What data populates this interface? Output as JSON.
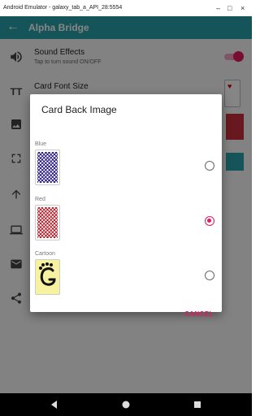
{
  "window": {
    "title": "Android Emulator - galaxy_tab_a_API_28:5554"
  },
  "appbar": {
    "title": "Alpha Bridge"
  },
  "settings": {
    "sound_title": "Sound Effects",
    "sound_subtitle": "Tap to turn sound ON/OFF",
    "font_title": "Card Font Size",
    "sound_enabled": true
  },
  "dialog": {
    "title": "Card Back Image",
    "options": [
      {
        "label": "Blue",
        "selected": false
      },
      {
        "label": "Red",
        "selected": true
      },
      {
        "label": "Cartoon",
        "selected": false
      }
    ],
    "cancel_label": "CANCEL"
  },
  "colors": {
    "teal": "#2aa3ab",
    "accent": "#e5195e"
  }
}
